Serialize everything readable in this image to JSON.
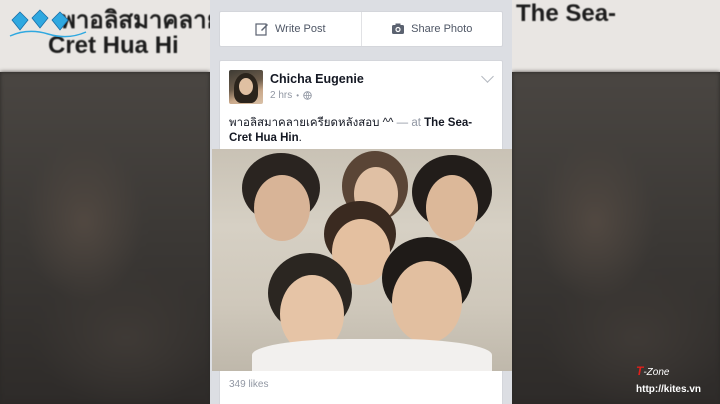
{
  "background": {
    "left_heading_line1": "พาอลิสมาคลาย",
    "left_heading_line2": "Cret Hua Hi",
    "right_heading": "The Sea-"
  },
  "composer": {
    "write_post_label": "Write Post",
    "share_photo_label": "Share Photo",
    "write_icon": "pencil-square-icon",
    "photo_icon": "camera-icon"
  },
  "post": {
    "author": "Chicha Eugenie",
    "time": "2 hrs",
    "privacy_icon": "globe-icon",
    "caption_text": "พาอลิสมาคลายเครียดหลังสอบ ^^",
    "caption_at": " — at ",
    "caption_place": "The Sea-Cret Hua Hin",
    "caption_end": ".",
    "likes": "349 likes"
  },
  "watermark": {
    "brand_t": "T",
    "brand_rest": "-Zone",
    "url": "http://kites.vn"
  }
}
